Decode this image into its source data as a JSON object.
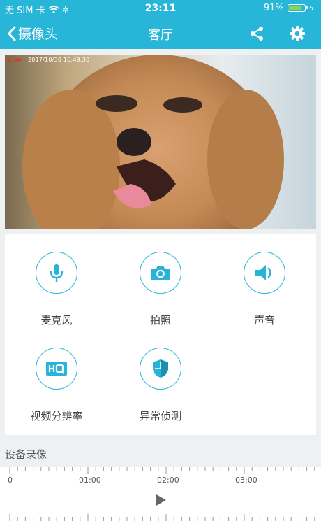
{
  "status_bar": {
    "carrier": "无 SIM 卡",
    "time": "23:11",
    "battery": "91%",
    "battery_level": 0.91
  },
  "nav": {
    "back_label": "摄像头",
    "title": "客厅"
  },
  "video": {
    "live": "Live",
    "timestamp": "2017/10/30 16:49:30"
  },
  "controls": [
    {
      "label": "麦克风",
      "icon": "microphone-icon"
    },
    {
      "label": "拍照",
      "icon": "camera-icon"
    },
    {
      "label": "声音",
      "icon": "speaker-icon"
    },
    {
      "label": "视频分辨率",
      "icon": "hq-icon"
    },
    {
      "label": "异常侦测",
      "icon": "shield-icon"
    }
  ],
  "recording": {
    "section_title": "设备录像",
    "timeline_labels": [
      "0",
      "01:00",
      "02:00",
      "03:00"
    ]
  },
  "colors": {
    "accent": "#28b6d8",
    "battery": "#7ed957",
    "live": "#e0322a"
  }
}
